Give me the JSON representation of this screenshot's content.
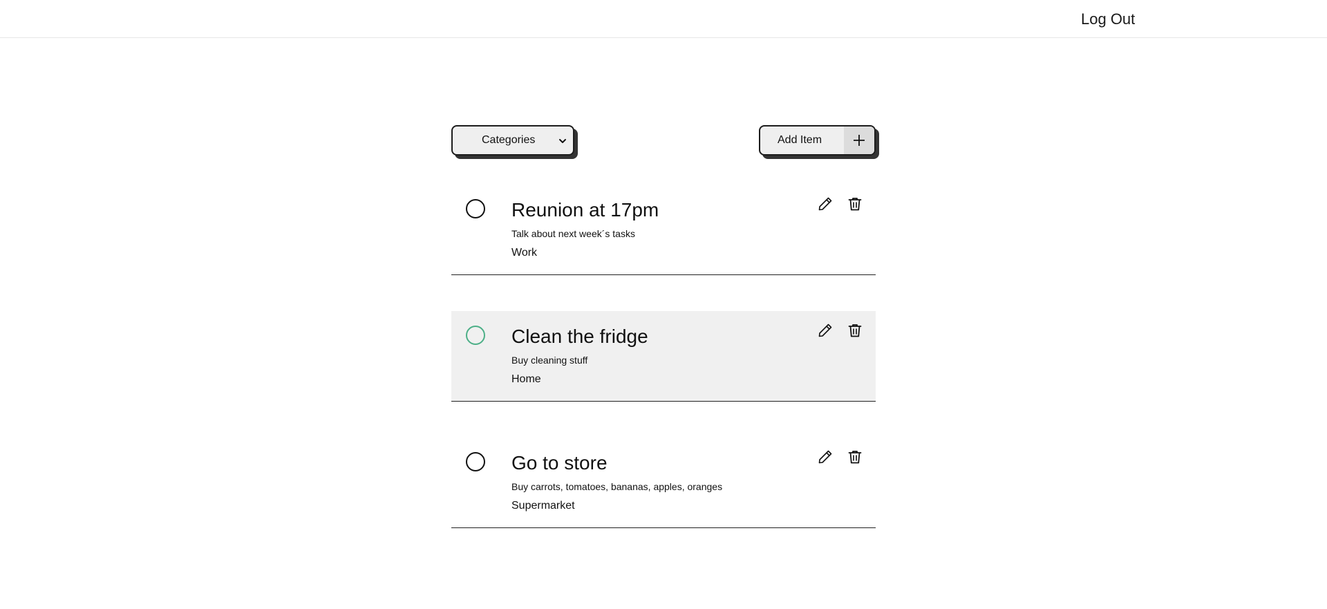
{
  "header": {
    "logout_label": "Log Out"
  },
  "toolbar": {
    "categories_label": "Categories",
    "add_item_label": "Add Item"
  },
  "colors": {
    "accent_green": "#4caf87",
    "highlight_bg": "#f0f0f0",
    "button_bg": "#efefef"
  },
  "items": [
    {
      "title": "Reunion at 17pm",
      "description": "Talk about next week´s tasks",
      "category": "Work"
    },
    {
      "title": "Clean the fridge",
      "description": "Buy cleaning stuff",
      "category": "Home"
    },
    {
      "title": "Go to store",
      "description": "Buy carrots, tomatoes, bananas, apples, oranges",
      "category": "Supermarket"
    }
  ]
}
